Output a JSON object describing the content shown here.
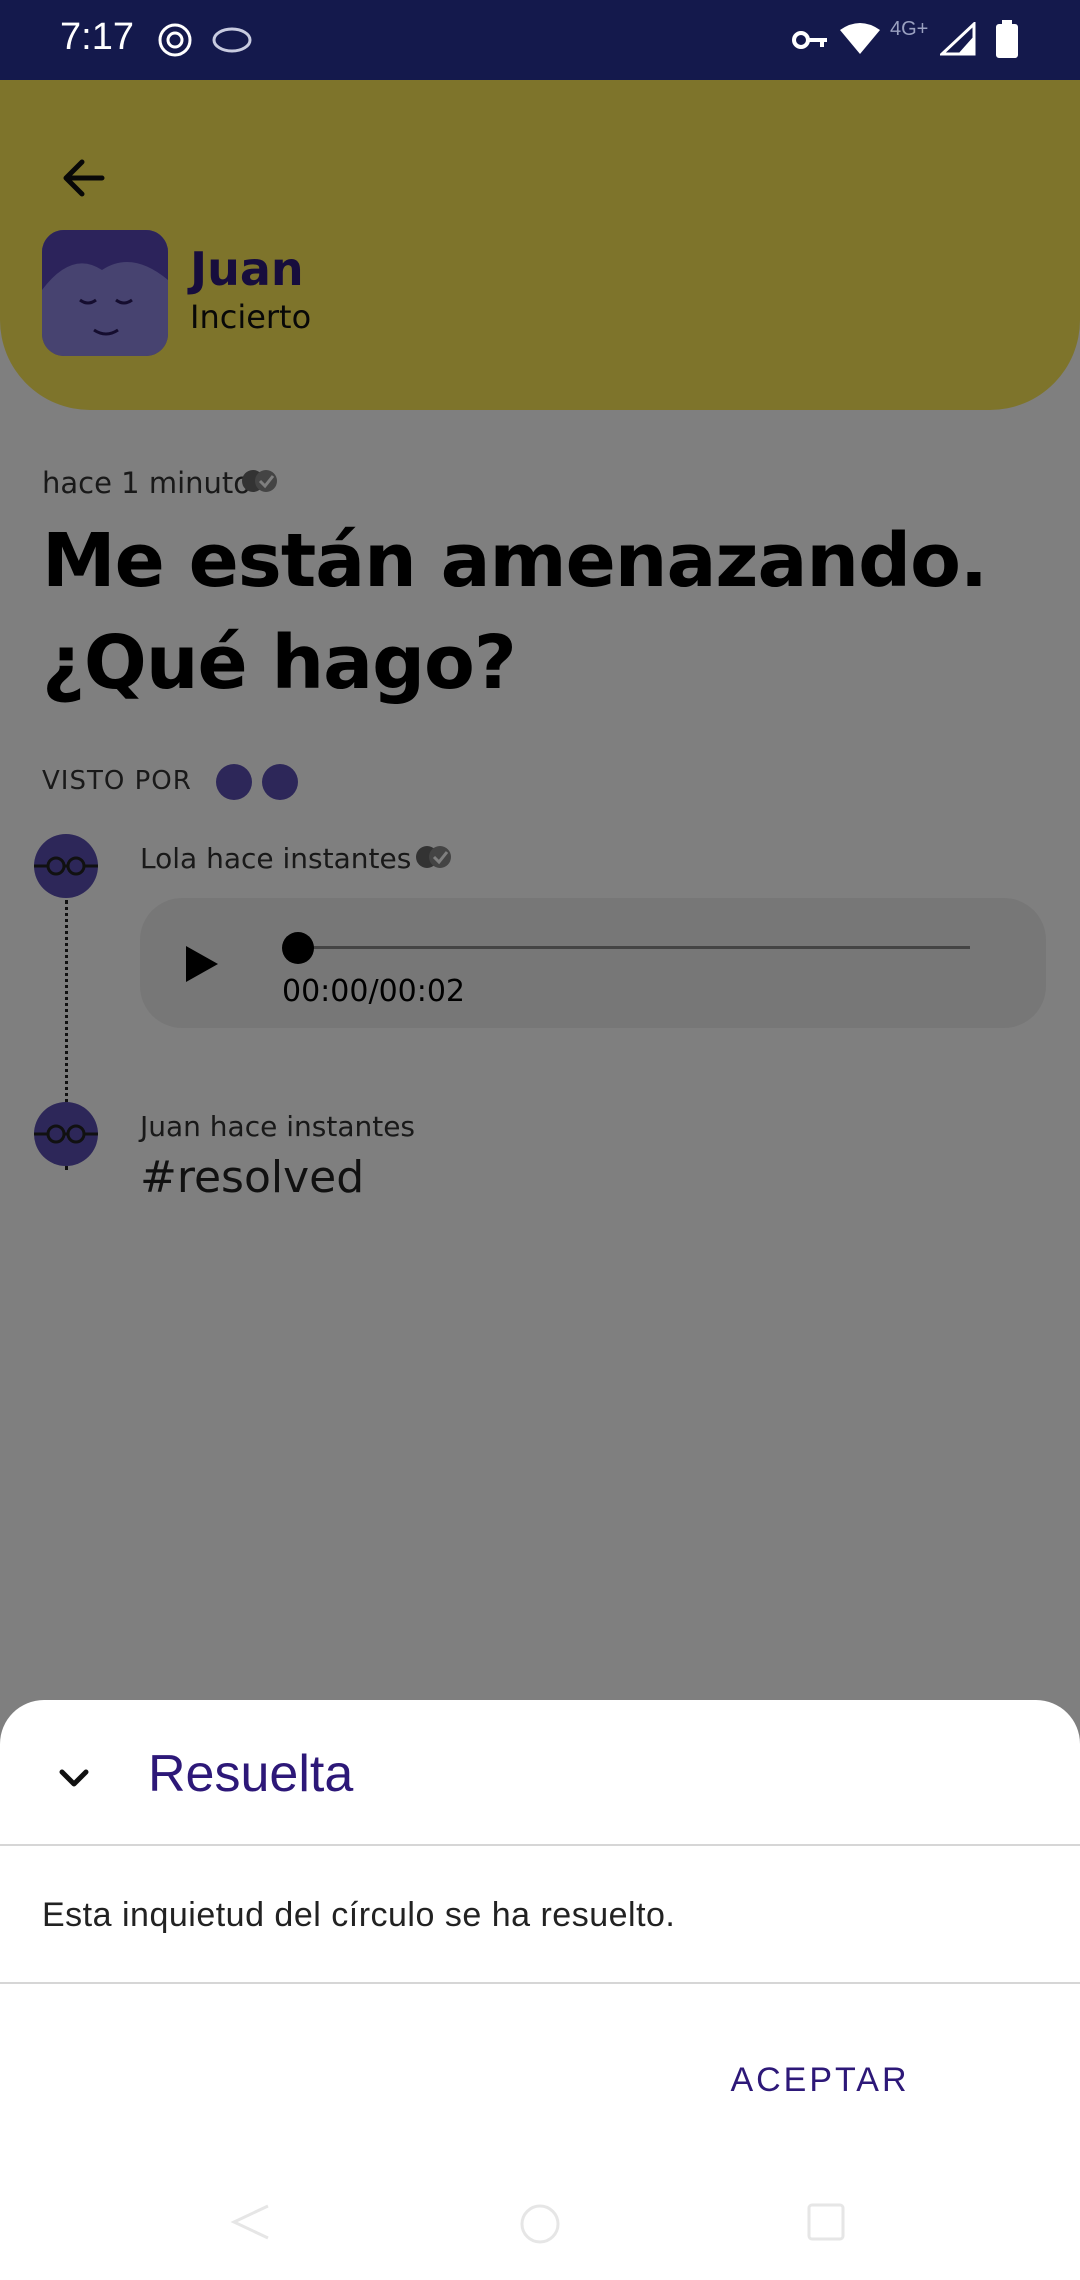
{
  "status_bar": {
    "time": "7:17",
    "network_label": "4G+"
  },
  "header": {
    "name": "Juan",
    "status": "Incierto",
    "color": "#fde957"
  },
  "post": {
    "time_ago": "hace 1 minuto",
    "question": "Me están amenazando. ¿Qué hago?"
  },
  "seen_by": {
    "label": "VISTO POR"
  },
  "thread": {
    "messages": [
      {
        "meta": "Lola hace instantes",
        "type": "audio",
        "audio_time": "00:00/00:02",
        "progress": 0
      },
      {
        "meta": "Juan hace instantes",
        "text": "#resolved"
      }
    ]
  },
  "sheet": {
    "title": "Resuelta",
    "message": "Esta inquietud del círculo se ha resuelto.",
    "accept_label": "ACEPTAR",
    "accent_color": "#2d1878"
  },
  "icons": {
    "status_bar": [
      "wifi-icon",
      "signal-icon",
      "battery-icon",
      "vpn-key-icon"
    ],
    "nav": [
      "back-nav-icon",
      "home-nav-icon",
      "recents-nav-icon"
    ]
  }
}
